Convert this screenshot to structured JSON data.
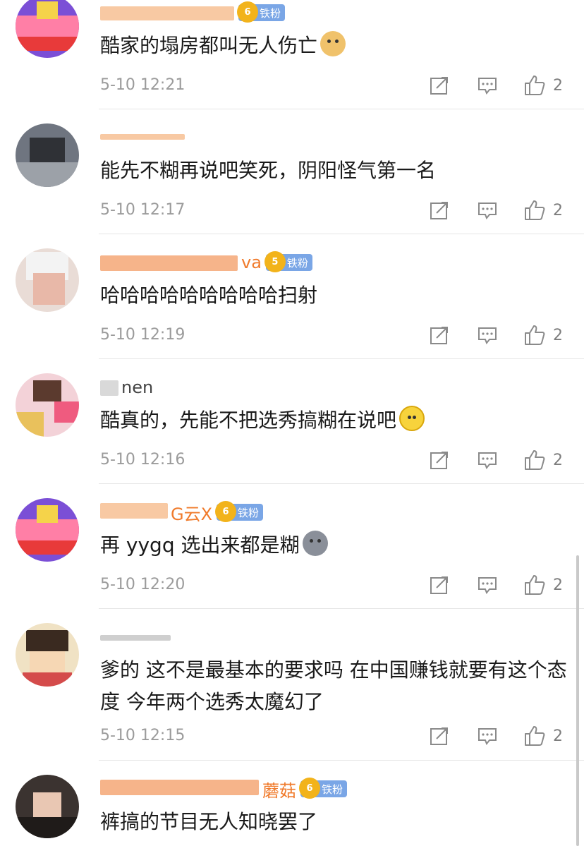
{
  "comments": [
    {
      "username": "[redacted]",
      "badge": "铁粉",
      "badge_level": "6",
      "text": "酷家的塌房都叫无人伤亡",
      "emoji": "doge-emoji",
      "time": "5-10 12:21",
      "likes": "2"
    },
    {
      "username": "[redacted]",
      "badge": "",
      "badge_level": "",
      "text": "能先不糊再说吧笑死，阴阳怪气第一名",
      "emoji": "",
      "time": "5-10 12:17",
      "likes": "2"
    },
    {
      "username": "va",
      "badge": "铁粉",
      "badge_level": "5",
      "text": "哈哈哈哈哈哈哈哈哈扫射",
      "emoji": "",
      "time": "5-10 12:19",
      "likes": "2"
    },
    {
      "username": "nen",
      "badge": "",
      "badge_level": "",
      "text": "酷真的，先能不把选秀搞糊在说吧",
      "emoji": "smile-emoji",
      "time": "5-10 12:16",
      "likes": "2"
    },
    {
      "username": "G云X",
      "badge": "铁粉",
      "badge_level": "6",
      "text": "再 yygq 选出来都是糊",
      "emoji": "husky-emoji",
      "time": "5-10 12:20",
      "likes": "2"
    },
    {
      "username": "[redacted]",
      "badge": "",
      "badge_level": "",
      "text": "爹的 这不是最基本的要求吗 在中国赚钱就要有这个态度 今年两个选秀太魔幻了",
      "emoji": "",
      "time": "5-10 12:15",
      "likes": "2"
    },
    {
      "username": "蘑菇",
      "badge": "铁粉",
      "badge_level": "6",
      "text": "裤搞的节目无人知晓罢了",
      "emoji": "",
      "time": "",
      "likes": ""
    }
  ],
  "colors": {
    "username": "#f07b2c",
    "badge": "#7aa6e6",
    "crown": "#f2b31b",
    "meta": "#9b9b9b"
  },
  "icons": [
    "share-icon",
    "comment-icon",
    "like-icon"
  ]
}
